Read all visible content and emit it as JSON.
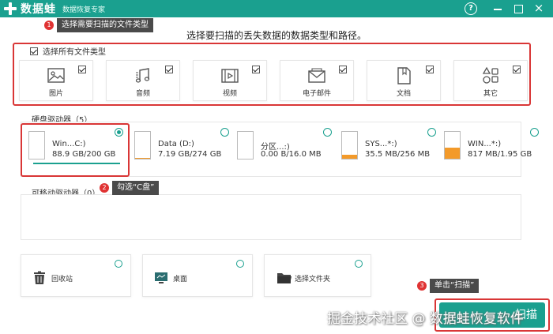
{
  "app": {
    "name": "数据蛙",
    "subtitle": "数据恢复专家",
    "help_label": "?",
    "close_label": "×",
    "brand_color": "#1aa08f"
  },
  "annotations": [
    {
      "step": "1",
      "text": "选择需要扫描的文件类型"
    },
    {
      "step": "2",
      "text": "勾选“C盘”"
    },
    {
      "step": "3",
      "text": "单击“扫描”"
    }
  ],
  "instruction": "选择要扫描的丢失数据的数据类型和路径。",
  "file_types": {
    "select_all_label": "选择所有文件类型",
    "select_all_checked": true,
    "items": [
      {
        "label": "图片",
        "icon": "image-icon",
        "checked": true
      },
      {
        "label": "音频",
        "icon": "music-note-icon",
        "checked": true
      },
      {
        "label": "视频",
        "icon": "video-film-icon",
        "checked": true
      },
      {
        "label": "电子邮件",
        "icon": "envelope-icon",
        "checked": true
      },
      {
        "label": "文档",
        "icon": "document-icon",
        "checked": true
      },
      {
        "label": "其它",
        "icon": "shapes-icon",
        "checked": true
      }
    ]
  },
  "hard_drives": {
    "label": "硬盘驱动器（5）",
    "items": [
      {
        "name": "Win...C:)",
        "size": "88.9 GB/200 GB",
        "selected": true,
        "used_fraction": 0.44
      },
      {
        "name": "Data (D:)",
        "size": "7.19 GB/274 GB",
        "selected": false,
        "used_fraction": 0.03
      },
      {
        "name": "分区...:)",
        "size": "0.00  B/16.0 MB",
        "selected": false,
        "used_fraction": 0.0
      },
      {
        "name": "SYS...*:)",
        "size": "35.5 MB/256 MB",
        "selected": false,
        "used_fraction": 0.14
      },
      {
        "name": "WIN...*:)",
        "size": "817 MB/1.95 GB",
        "selected": false,
        "used_fraction": 0.42
      }
    ]
  },
  "removable_drives": {
    "label": "可移动驱动器（0）"
  },
  "locations": [
    {
      "label": "回收站",
      "icon": "recycle-bin-icon"
    },
    {
      "label": "桌面",
      "icon": "desktop-icon"
    },
    {
      "label": "选择文件夹",
      "icon": "folder-icon"
    }
  ],
  "watermark": "掘金技术社区 @ 数据蛙恢复软件",
  "scan_button_label": "扫描"
}
